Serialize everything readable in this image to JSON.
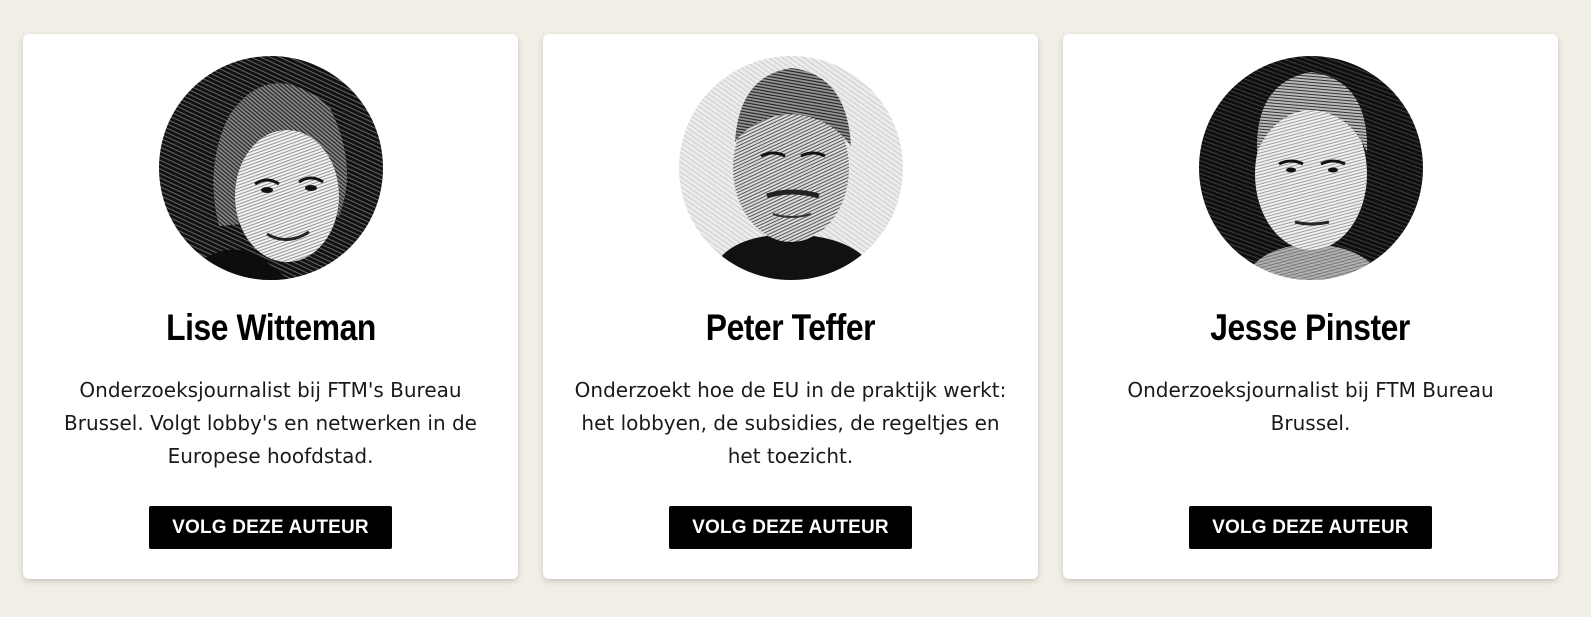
{
  "authors": [
    {
      "name": "Lise Witteman",
      "bio": "Onderzoeksjournalist bij FTM's Bureau Brussel. Volgt lobby's en netwerken in de Europese hoofdstad.",
      "follow_label": "VOLG DEZE AUTEUR",
      "portrait_style": "dark-background"
    },
    {
      "name": "Peter Teffer",
      "bio": "Onderzoekt hoe de EU in de praktijk werkt: het lobbyen, de subsidies, de regeltjes en het toezicht.",
      "follow_label": "VOLG DEZE AUTEUR",
      "portrait_style": "light-background"
    },
    {
      "name": "Jesse Pinster",
      "bio": "Onderzoeksjournalist bij FTM Bureau Brussel.",
      "follow_label": "VOLG DEZE AUTEUR",
      "portrait_style": "dark-background"
    }
  ],
  "colors": {
    "page_background": "#f1efe5",
    "card_background": "#ffffff",
    "button_background": "#000000",
    "button_text": "#ffffff"
  }
}
